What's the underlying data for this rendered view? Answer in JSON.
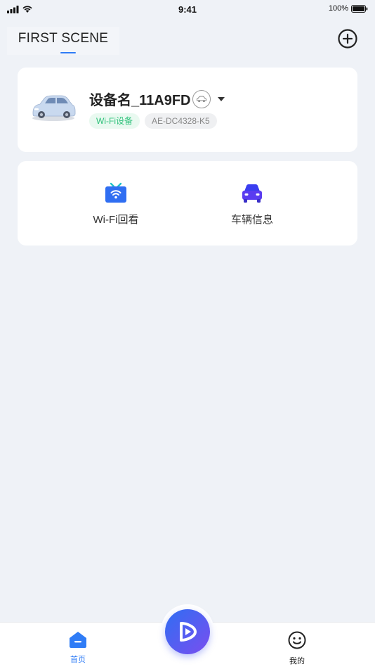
{
  "status_bar": {
    "time": "9:41",
    "battery": "100%"
  },
  "header": {
    "scene_title": "FIRST SCENE"
  },
  "device": {
    "name": "设备名_11A9FD",
    "tags": [
      "Wi-Fi设备",
      "AE-DC4328-K5"
    ]
  },
  "features": [
    {
      "label": "Wi-Fi回看",
      "icon": "wifi-playback-icon"
    },
    {
      "label": "车辆信息",
      "icon": "car-info-icon"
    }
  ],
  "tab_bar": {
    "home_label": "首页",
    "mine_label": "我的"
  },
  "colors": {
    "accent": "#2f7cf6",
    "background": "#eff2f7",
    "wifi_tag_text": "#2ec17a",
    "car_icon": "#5a3cf0"
  }
}
